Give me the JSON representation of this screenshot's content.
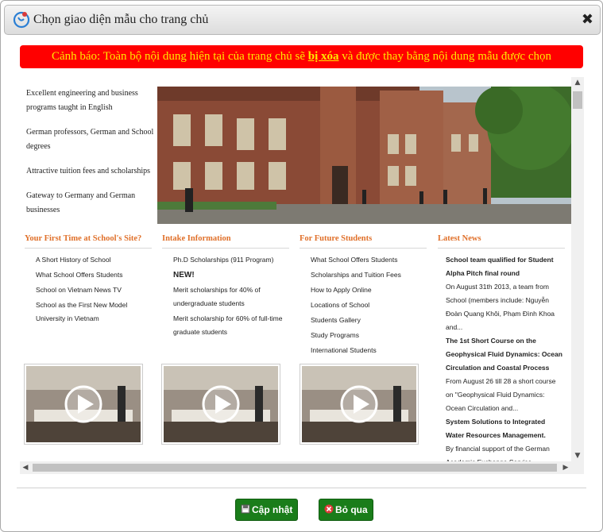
{
  "dialog": {
    "title": "Chọn giao diện mẫu cho trang chủ",
    "close_label": "✖"
  },
  "warning": {
    "prefix": "Cảnh báo: Toàn bộ nội dung hiện tại của trang chủ sẽ ",
    "emphasis": "bị xóa",
    "suffix": " và được thay bằng nội dung mẫu được chọn"
  },
  "preview": {
    "features": [
      "Excellent engineering and business programs taught in English",
      "German professors, German and School degrees",
      "Attractive tuition fees and scholarships",
      "Gateway to Germany and German businesses"
    ],
    "columns": [
      {
        "heading": "Your First Time at School's Site?",
        "items": [
          "A Short History of School",
          "What School Offers Students",
          "School on Vietnam News TV",
          "School as the First New Model University in Vietnam"
        ]
      },
      {
        "heading": "Intake Information",
        "items": [
          "Ph.D Scholarships (911 Program)",
          "NEW!",
          "Merit scholarships for 40% of undergraduate students",
          "Merit scholarship for 60% of full-time graduate students"
        ]
      },
      {
        "heading": "For Future Students",
        "items": [
          "What School Offers Students",
          "Scholarships and Tuition Fees",
          "How to Apply Online",
          "Locations of School",
          "Students Gallery",
          "Study Programs",
          "International Students"
        ]
      }
    ],
    "news": {
      "heading": "Latest News",
      "items": [
        {
          "title": "School team qualified for Student Alpha Pitch final round",
          "body": "On August 31th 2013, a team from School (members include: Nguyễn Đoàn Quang Khôi, Phạm Đình Khoa and..."
        },
        {
          "title": "The 1st Short Course on the Geophysical Fluid Dynamics: Ocean Circulation and Coastal Process",
          "body": "From August 26 till 28 a short course on \"Geophysical Fluid Dynamics: Ocean Circulation and..."
        },
        {
          "title": "System Solutions to Integrated Water Resources Management.",
          "body": "By financial support of the German Academic Exchange Service"
        }
      ]
    }
  },
  "buttons": {
    "update_label": "Cập nhật",
    "skip_label": "Bỏ qua"
  },
  "colors": {
    "warning_bg": "#ff0000",
    "warning_text": "#ffe800",
    "heading_orange": "#e0702a",
    "button_green": "#1a7d1a"
  }
}
